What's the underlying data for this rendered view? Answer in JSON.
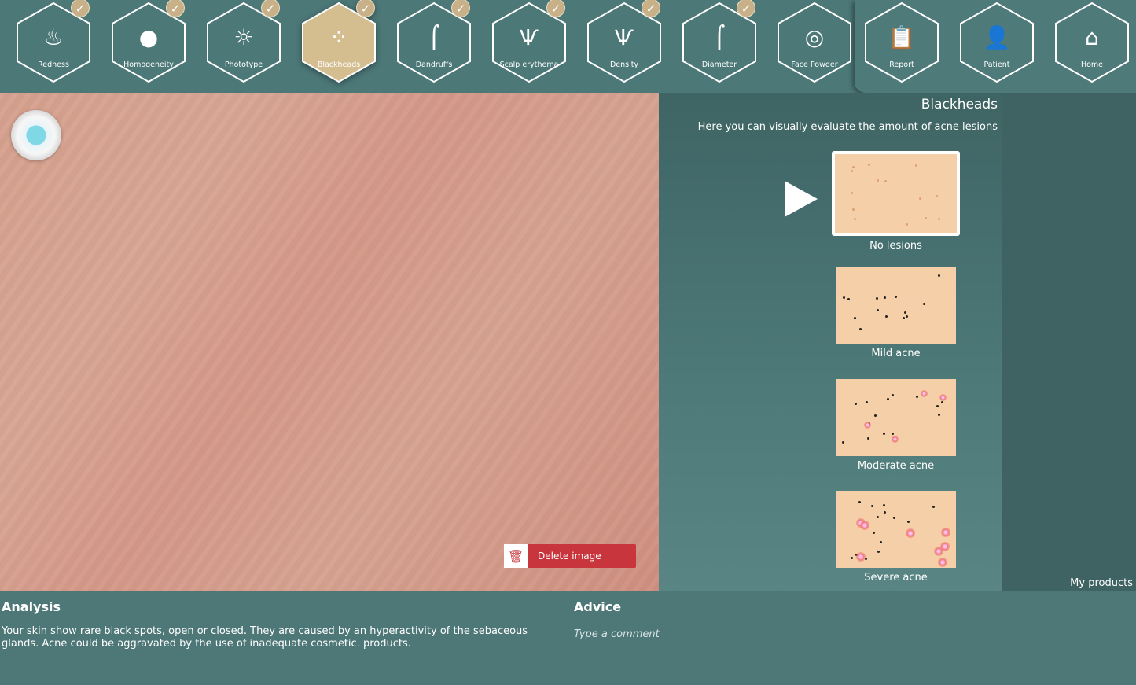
{
  "nav": {
    "items": [
      {
        "label": "Redness",
        "icon": "flame-icon",
        "glyph": "♨",
        "checked": true,
        "active": false
      },
      {
        "label": "Homogeneity",
        "icon": "blob-icon",
        "glyph": "●",
        "checked": true,
        "active": false
      },
      {
        "label": "Phototype",
        "icon": "sun-icon",
        "glyph": "☼",
        "checked": true,
        "active": false
      },
      {
        "label": "Blackheads",
        "icon": "dots-icon",
        "glyph": "⁘",
        "checked": true,
        "active": true
      },
      {
        "label": "Dandruffs",
        "icon": "hair-flakes-icon",
        "glyph": "⌠",
        "checked": true,
        "active": false
      },
      {
        "label": "Scalp erythema",
        "icon": "hair-tuft-icon",
        "glyph": "Ѱ",
        "checked": true,
        "active": false
      },
      {
        "label": "Density",
        "icon": "hair-density-icon",
        "glyph": "Ѱ",
        "checked": true,
        "active": false
      },
      {
        "label": "Diameter",
        "icon": "hair-diameter-icon",
        "glyph": "⌠",
        "checked": true,
        "active": false
      },
      {
        "label": "Face Powder",
        "icon": "compact-icon",
        "glyph": "◎",
        "checked": false,
        "active": false
      }
    ],
    "right_items": [
      {
        "label": "Report",
        "icon": "clipboard-icon",
        "glyph": "📋"
      },
      {
        "label": "Patient",
        "icon": "person-icon",
        "glyph": "👤"
      },
      {
        "label": "Home",
        "icon": "home-icon",
        "glyph": "⌂"
      }
    ]
  },
  "image": {
    "delete_label": "Delete image"
  },
  "panel": {
    "title": "Blackheads",
    "subtitle": "Here you can visually evaluate the amount of acne lesions",
    "options": [
      {
        "label": "No lesions",
        "selected": true
      },
      {
        "label": "Mild acne",
        "selected": false
      },
      {
        "label": "Moderate acne",
        "selected": false
      },
      {
        "label": "Severe acne",
        "selected": false
      }
    ]
  },
  "my_products": "My products",
  "analysis": {
    "title": "Analysis",
    "text": "Your skin show rare black spots, open or closed. They are caused by an hyperactivity of the sebaceous glands. Acne could be aggravated by the use of inadequate cosmetic. products."
  },
  "advice": {
    "title": "Advice",
    "placeholder": "Type a comment"
  },
  "colors": {
    "active": "#d4bd8f",
    "check": "#c8b089",
    "delete": "#c8353d",
    "skin_thumb": "#f5cfa8"
  }
}
